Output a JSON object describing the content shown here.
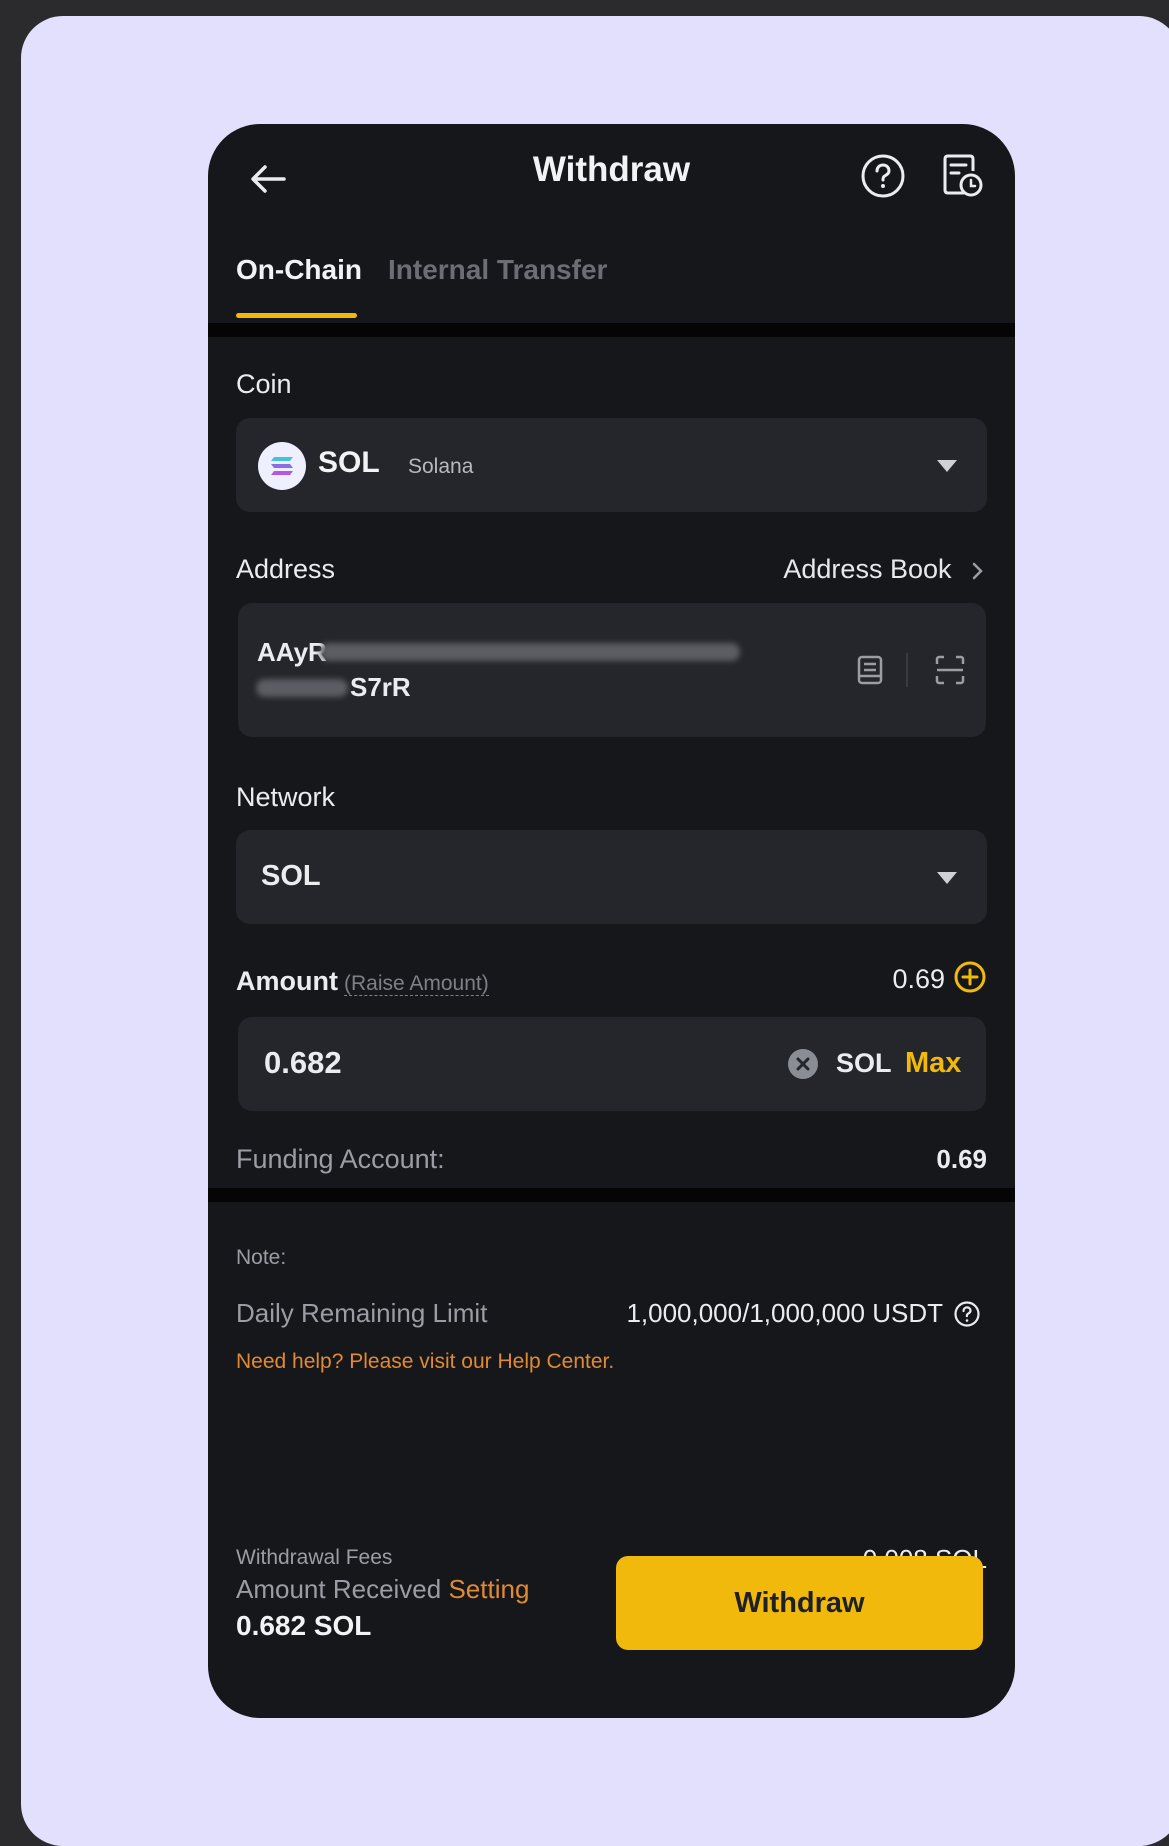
{
  "header": {
    "title": "Withdraw"
  },
  "tabs": [
    {
      "label": "On-Chain",
      "active": true
    },
    {
      "label": "Internal Transfer",
      "active": false
    }
  ],
  "coin": {
    "label": "Coin",
    "symbol": "SOL",
    "name": "Solana"
  },
  "address": {
    "label": "Address",
    "book_label": "Address Book",
    "value_start": "AAyR",
    "value_end": "S7rR"
  },
  "network": {
    "label": "Network",
    "value": "SOL"
  },
  "amount": {
    "label": "Amount",
    "raise_label": "(Raise Amount)",
    "balance": "0.69",
    "value": "0.682",
    "unit": "SOL",
    "max_label": "Max"
  },
  "funding": {
    "label": "Funding Account:",
    "value": "0.69"
  },
  "note": {
    "label": "Note:",
    "limit_label": "Daily Remaining Limit",
    "limit_value": "1,000,000/1,000,000 USDT",
    "help_text": "Need help? Please visit our Help Center."
  },
  "footer": {
    "fees_label": "Withdrawal Fees",
    "fees_value": "0.008 SOL",
    "received_label": "Amount Received",
    "setting_label": "Setting",
    "received_value": "0.682 SOL",
    "withdraw_label": "Withdraw"
  },
  "colors": {
    "accent": "#f0b90b",
    "link": "#e08a33",
    "background": "#16171b",
    "field": "#25262b"
  }
}
